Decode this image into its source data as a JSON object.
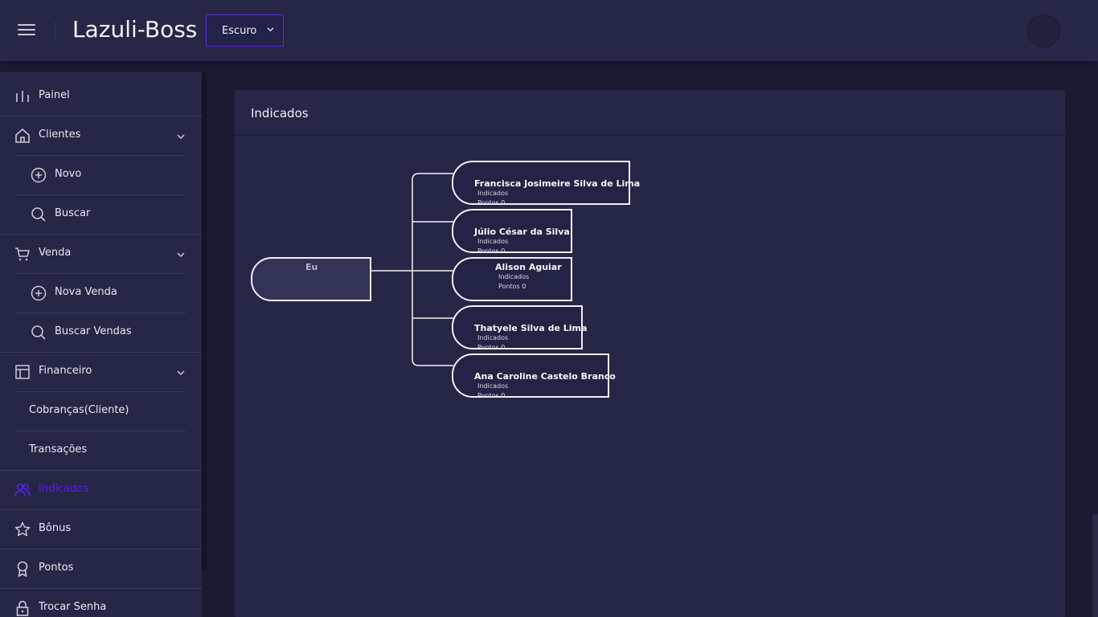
{
  "header": {
    "app_title": "Lazuli-Boss",
    "theme_select": {
      "value": "Escuro"
    }
  },
  "sidebar": {
    "items": [
      {
        "label": "Painel",
        "icon": "bar-chart-icon"
      },
      {
        "label": "Clientes",
        "icon": "home-icon",
        "expandable": true
      },
      {
        "label": "Novo",
        "icon": "plus-circle-icon"
      },
      {
        "label": "Buscar",
        "icon": "search-icon"
      },
      {
        "label": "Venda",
        "icon": "cart-icon",
        "expandable": true
      },
      {
        "label": "Nova Venda",
        "icon": "plus-circle-icon"
      },
      {
        "label": "Buscar Vendas",
        "icon": "search-icon"
      },
      {
        "label": "Financeiro",
        "icon": "layout-icon",
        "expandable": true
      },
      {
        "label": "Cobranças(Cliente)"
      },
      {
        "label": "Transações"
      },
      {
        "label": "Indicados",
        "icon": "users-icon",
        "active": true
      },
      {
        "label": "Bônus",
        "icon": "star-icon"
      },
      {
        "label": "Pontos",
        "icon": "award-icon"
      },
      {
        "label": "Trocar Senha",
        "icon": "lock-icon"
      }
    ]
  },
  "card": {
    "title": "Indicados"
  },
  "tree": {
    "root": {
      "label": "Eu"
    },
    "children": [
      {
        "name": "Francisca Josimeire Silva de Lima",
        "indicados_label": "Indicados",
        "pontos_label": "Pontos 0"
      },
      {
        "name": "Júlio César da Silva",
        "indicados_label": "Indicados",
        "pontos_label": "Pontos 0"
      },
      {
        "name": "Alison Aguiar",
        "indicados_label": "Indicados",
        "pontos_label": "Pontos 0"
      },
      {
        "name": "Thatyele Silva de Lima",
        "indicados_label": "Indicados",
        "pontos_label": "Pontos 0"
      },
      {
        "name": "Ana Caroline Castelo Branco",
        "indicados_label": "Indicados",
        "pontos_label": "Pontos 0"
      }
    ]
  },
  "colors": {
    "accent": "#5a1ef0",
    "background": "#1b1a33",
    "panel": "#262647"
  }
}
